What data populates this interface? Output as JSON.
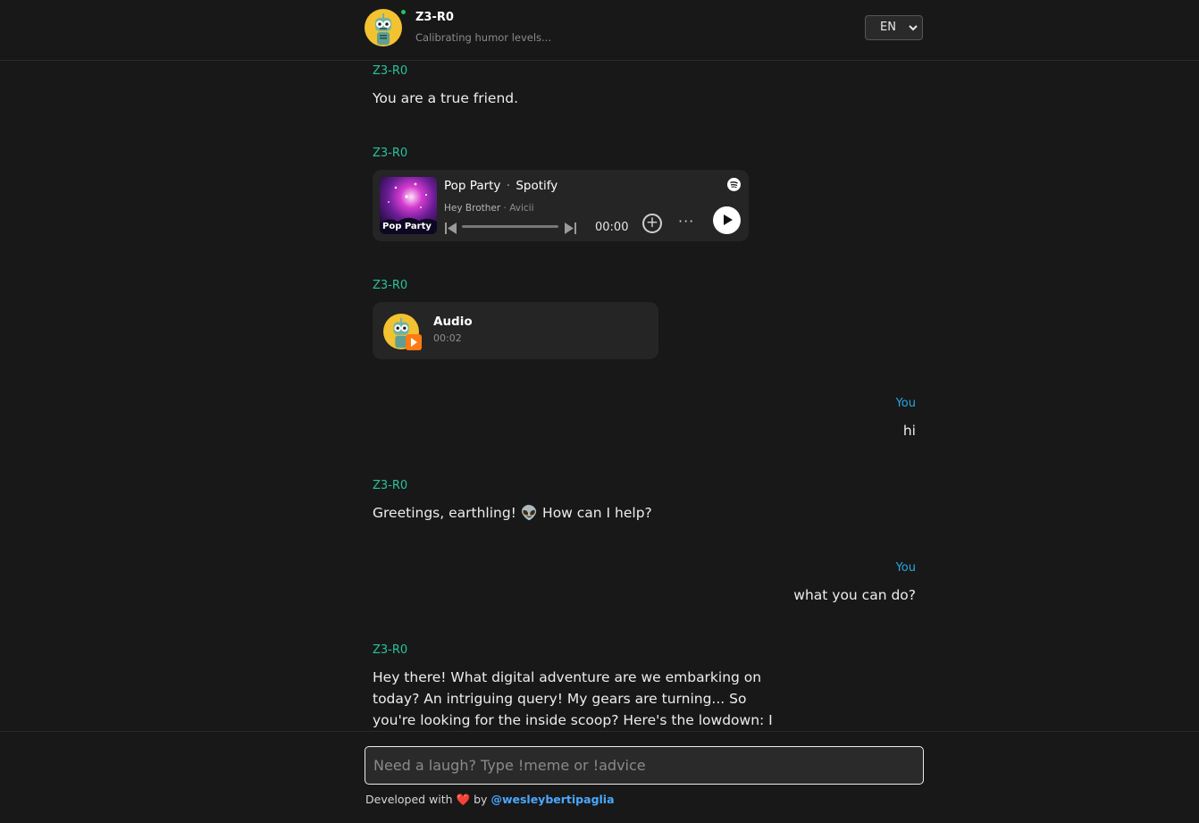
{
  "header": {
    "bot_name": "Z3-R0",
    "status": "Calibrating humor levels...",
    "language": "EN",
    "online_color": "#22c55e"
  },
  "messages": [
    {
      "sender": "Z3-R0",
      "text": "You are a true friend."
    },
    {
      "sender": "Z3-R0",
      "embed": "spotify"
    },
    {
      "sender": "Z3-R0",
      "embed": "audio"
    },
    {
      "sender": "You",
      "text": "hi"
    },
    {
      "sender": "Z3-R0",
      "text": "Greetings, earthling! 👽 How can I help?"
    },
    {
      "sender": "You",
      "text": "what you can do?"
    },
    {
      "sender": "Z3-R0",
      "lines": [
        "Hey there! What digital adventure are we embarking on",
        "today? An intriguing query! My gears are turning... So",
        "you're looking for the inside scoop? Here's the lowdown: I"
      ]
    }
  ],
  "spotify": {
    "playlist": "Pop Party",
    "separator": "·",
    "service": "Spotify",
    "track": "Hey Brother",
    "artist_separator": "·",
    "artist": "Avicii",
    "time": "00:00",
    "cover_label": "Pop Party",
    "add_symbol": "+",
    "more_symbol": "···"
  },
  "audio": {
    "title": "Audio",
    "duration": "00:02"
  },
  "input": {
    "placeholder": "Need a laugh? Type !meme or !advice"
  },
  "footer": {
    "prefix": "Developed with",
    "heart": "❤️",
    "by": "by",
    "handle": "@wesleybertipaglia"
  },
  "colors": {
    "bot_sender": "#27c39a",
    "user_sender": "#2aa7df",
    "background": "#181818",
    "accent_link": "#4aa8ff"
  }
}
